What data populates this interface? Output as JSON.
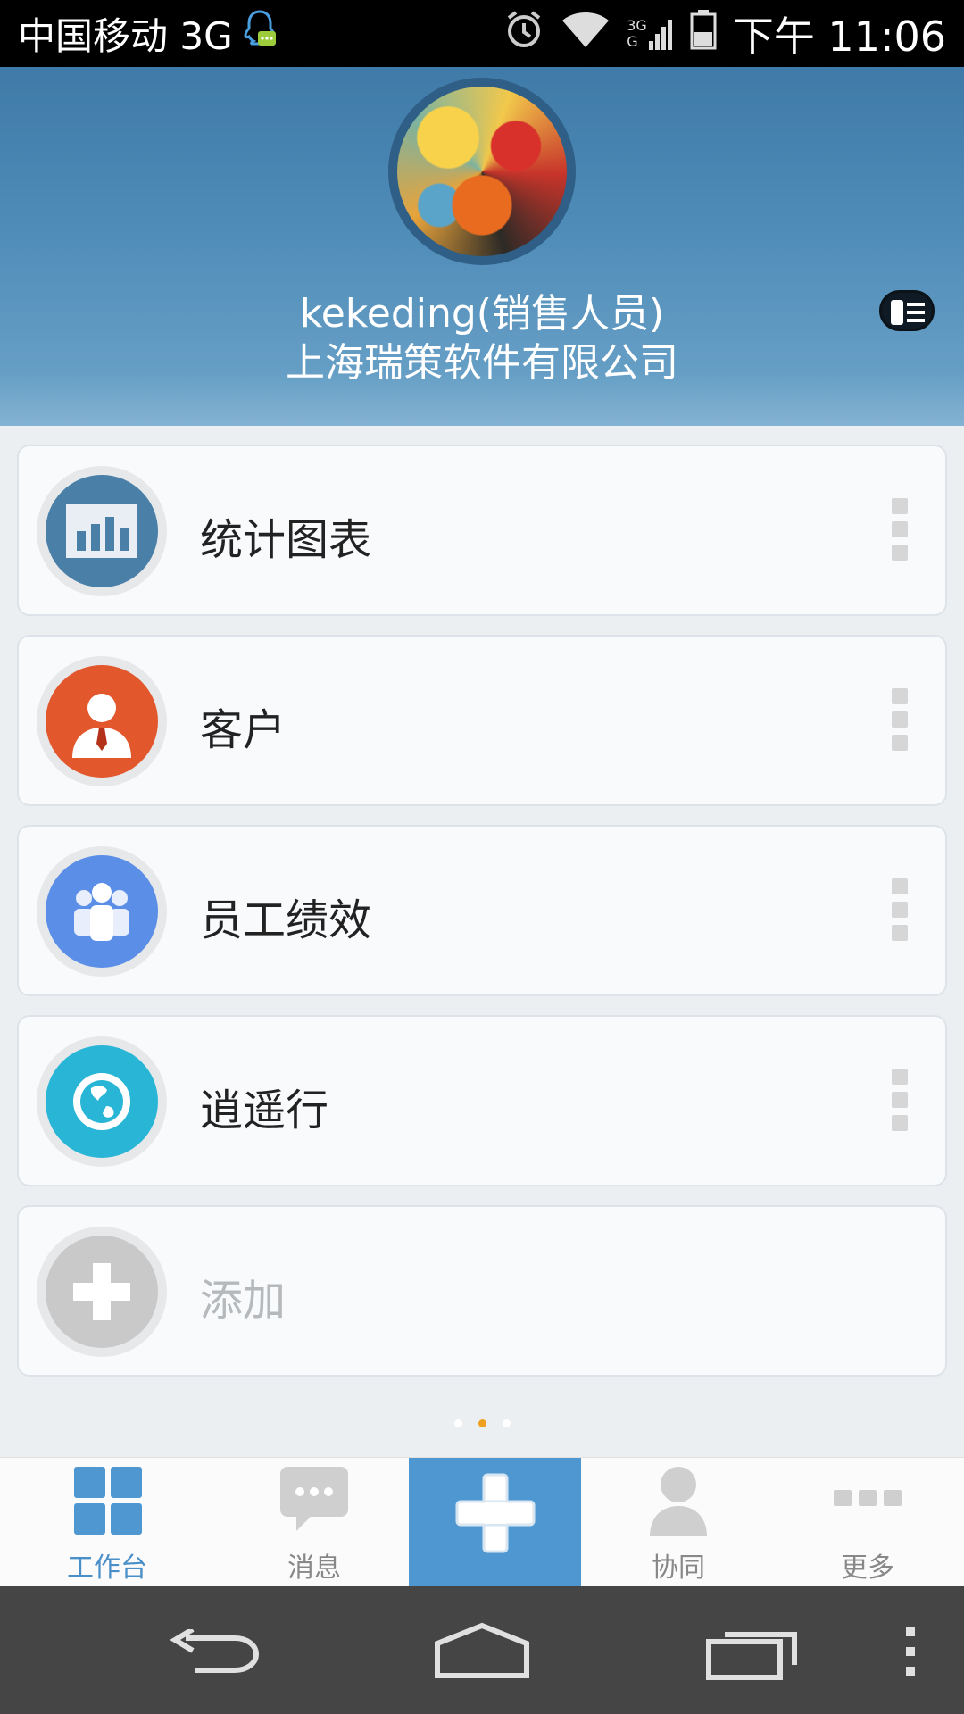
{
  "status_bar": {
    "carrier": "中国移动 3G",
    "network_small_top": "3G",
    "network_small_bottom": "G",
    "time": "下午 11:06"
  },
  "profile": {
    "name": "kekeding(销售人员)",
    "company": "上海瑞策软件有限公司"
  },
  "cards": [
    {
      "label": "统计图表",
      "icon": "bar-chart-icon",
      "color": "#4a7fa8"
    },
    {
      "label": "客户",
      "icon": "customer-person-icon",
      "color": "#e3572d"
    },
    {
      "label": "员工绩效",
      "icon": "team-people-icon",
      "color": "#5b8ee6"
    },
    {
      "label": "逍遥行",
      "icon": "globe-icon",
      "color": "#29b6d6"
    },
    {
      "label": "添加",
      "icon": "plus-icon",
      "color": "#c9c9c9"
    }
  ],
  "pager": {
    "pages": 3,
    "active_index": 1
  },
  "tabs": [
    {
      "label": "工作台",
      "icon": "grid-icon"
    },
    {
      "label": "消息",
      "icon": "chat-bubble-icon"
    },
    {
      "label": "",
      "icon": "plus-icon"
    },
    {
      "label": "协同",
      "icon": "person-icon"
    },
    {
      "label": "更多",
      "icon": "more-dots-icon"
    }
  ],
  "colors": {
    "accent": "#4f97d1",
    "header_blue": "#4f8cb8"
  }
}
